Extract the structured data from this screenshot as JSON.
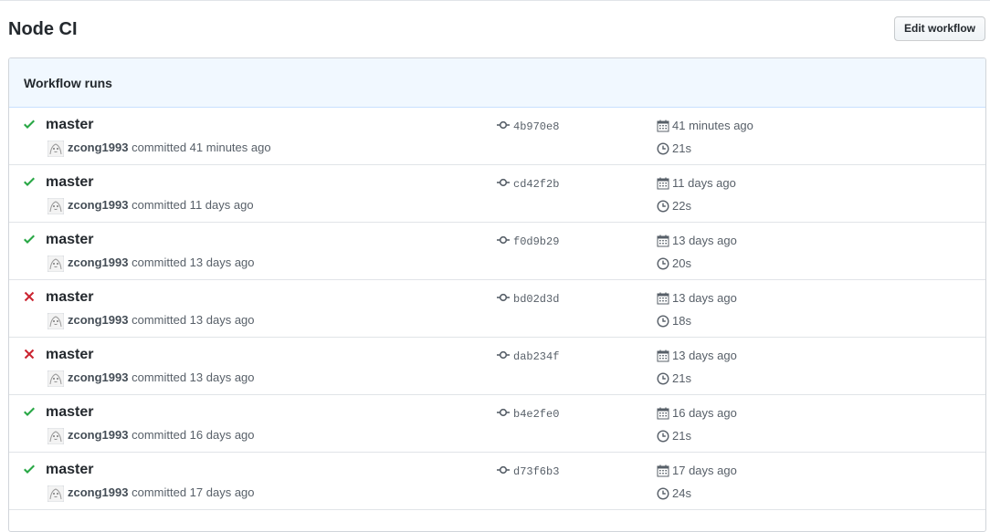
{
  "page": {
    "title": "Node CI",
    "edit_button": "Edit workflow"
  },
  "runs_box": {
    "header": "Workflow runs",
    "runs": [
      {
        "status": "success",
        "branch": "master",
        "user": "zcong1993",
        "committed": "committed 41 minutes ago",
        "sha": "4b970e8",
        "when": "41 minutes ago",
        "duration": "21s"
      },
      {
        "status": "success",
        "branch": "master",
        "user": "zcong1993",
        "committed": "committed 11 days ago",
        "sha": "cd42f2b",
        "when": "11 days ago",
        "duration": "22s"
      },
      {
        "status": "success",
        "branch": "master",
        "user": "zcong1993",
        "committed": "committed 13 days ago",
        "sha": "f0d9b29",
        "when": "13 days ago",
        "duration": "20s"
      },
      {
        "status": "failure",
        "branch": "master",
        "user": "zcong1993",
        "committed": "committed 13 days ago",
        "sha": "bd02d3d",
        "when": "13 days ago",
        "duration": "18s"
      },
      {
        "status": "failure",
        "branch": "master",
        "user": "zcong1993",
        "committed": "committed 13 days ago",
        "sha": "dab234f",
        "when": "13 days ago",
        "duration": "21s"
      },
      {
        "status": "success",
        "branch": "master",
        "user": "zcong1993",
        "committed": "committed 16 days ago",
        "sha": "b4e2fe0",
        "when": "16 days ago",
        "duration": "21s"
      },
      {
        "status": "success",
        "branch": "master",
        "user": "zcong1993",
        "committed": "committed 17 days ago",
        "sha": "d73f6b3",
        "when": "17 days ago",
        "duration": "24s"
      }
    ]
  },
  "colors": {
    "success": "#28a745",
    "failure": "#cb2431",
    "header_bg": "#f1f8ff"
  },
  "icons": {
    "success": "check-icon",
    "failure": "x-icon",
    "commit": "git-commit-icon",
    "calendar": "calendar-icon",
    "clock": "clock-icon"
  }
}
